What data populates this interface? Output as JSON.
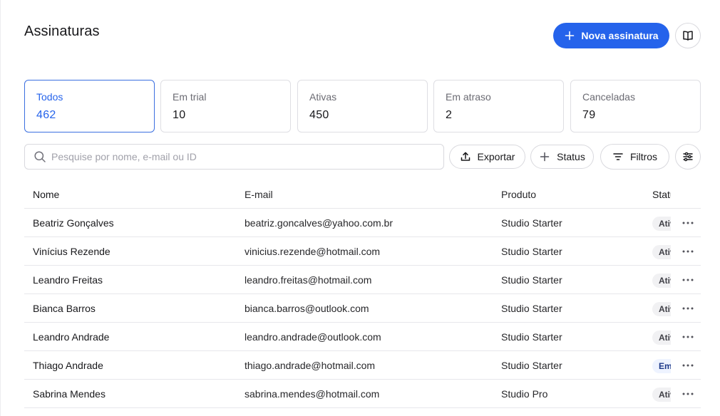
{
  "header": {
    "title": "Assinaturas",
    "new_button_label": "Nova assinatura"
  },
  "tabs": [
    {
      "label": "Todos",
      "count": "462",
      "active": true
    },
    {
      "label": "Em trial",
      "count": "10"
    },
    {
      "label": "Ativas",
      "count": "450"
    },
    {
      "label": "Em atraso",
      "count": "2"
    },
    {
      "label": "Canceladas",
      "count": "79"
    }
  ],
  "toolbar": {
    "search_placeholder": "Pesquise por nome, e-mail ou ID",
    "export_label": "Exportar",
    "status_label": "Status",
    "filters_label": "Filtros"
  },
  "table": {
    "columns": {
      "name": "Nome",
      "email": "E-mail",
      "product": "Produto",
      "status": "Status"
    },
    "rows": [
      {
        "name": "Beatriz Gonçalves",
        "email": "beatriz.goncalves@yahoo.com.br",
        "product": "Studio Starter",
        "status": "Ativa"
      },
      {
        "name": "Vinícius Rezende",
        "email": "vinicius.rezende@hotmail.com",
        "product": "Studio Starter",
        "status": "Ativa"
      },
      {
        "name": "Leandro Freitas",
        "email": "leandro.freitas@hotmail.com",
        "product": "Studio Starter",
        "status": "Ativa"
      },
      {
        "name": "Bianca Barros",
        "email": "bianca.barros@outlook.com",
        "product": "Studio Starter",
        "status": "Ativa"
      },
      {
        "name": "Leandro Andrade",
        "email": "leandro.andrade@outlook.com",
        "product": "Studio Starter",
        "status": "Ativa"
      },
      {
        "name": "Thiago Andrade",
        "email": "thiago.andrade@hotmail.com",
        "product": "Studio Starter",
        "status": "Em trial"
      },
      {
        "name": "Sabrina Mendes",
        "email": "sabrina.mendes@hotmail.com",
        "product": "Studio Pro",
        "status": "Ativa"
      }
    ]
  },
  "colors": {
    "accent": "#2563eb",
    "border": "#dedee3",
    "muted_text": "#6b6b73"
  },
  "icons": {
    "new_button": "plus-icon",
    "columns_toggle": "book-open-icon",
    "search": "search-icon",
    "export": "upload-icon",
    "status": "plus-icon",
    "filters": "filter-lines-icon",
    "settings": "sliders-icon",
    "row_menu": "more-horizontal-icon"
  }
}
